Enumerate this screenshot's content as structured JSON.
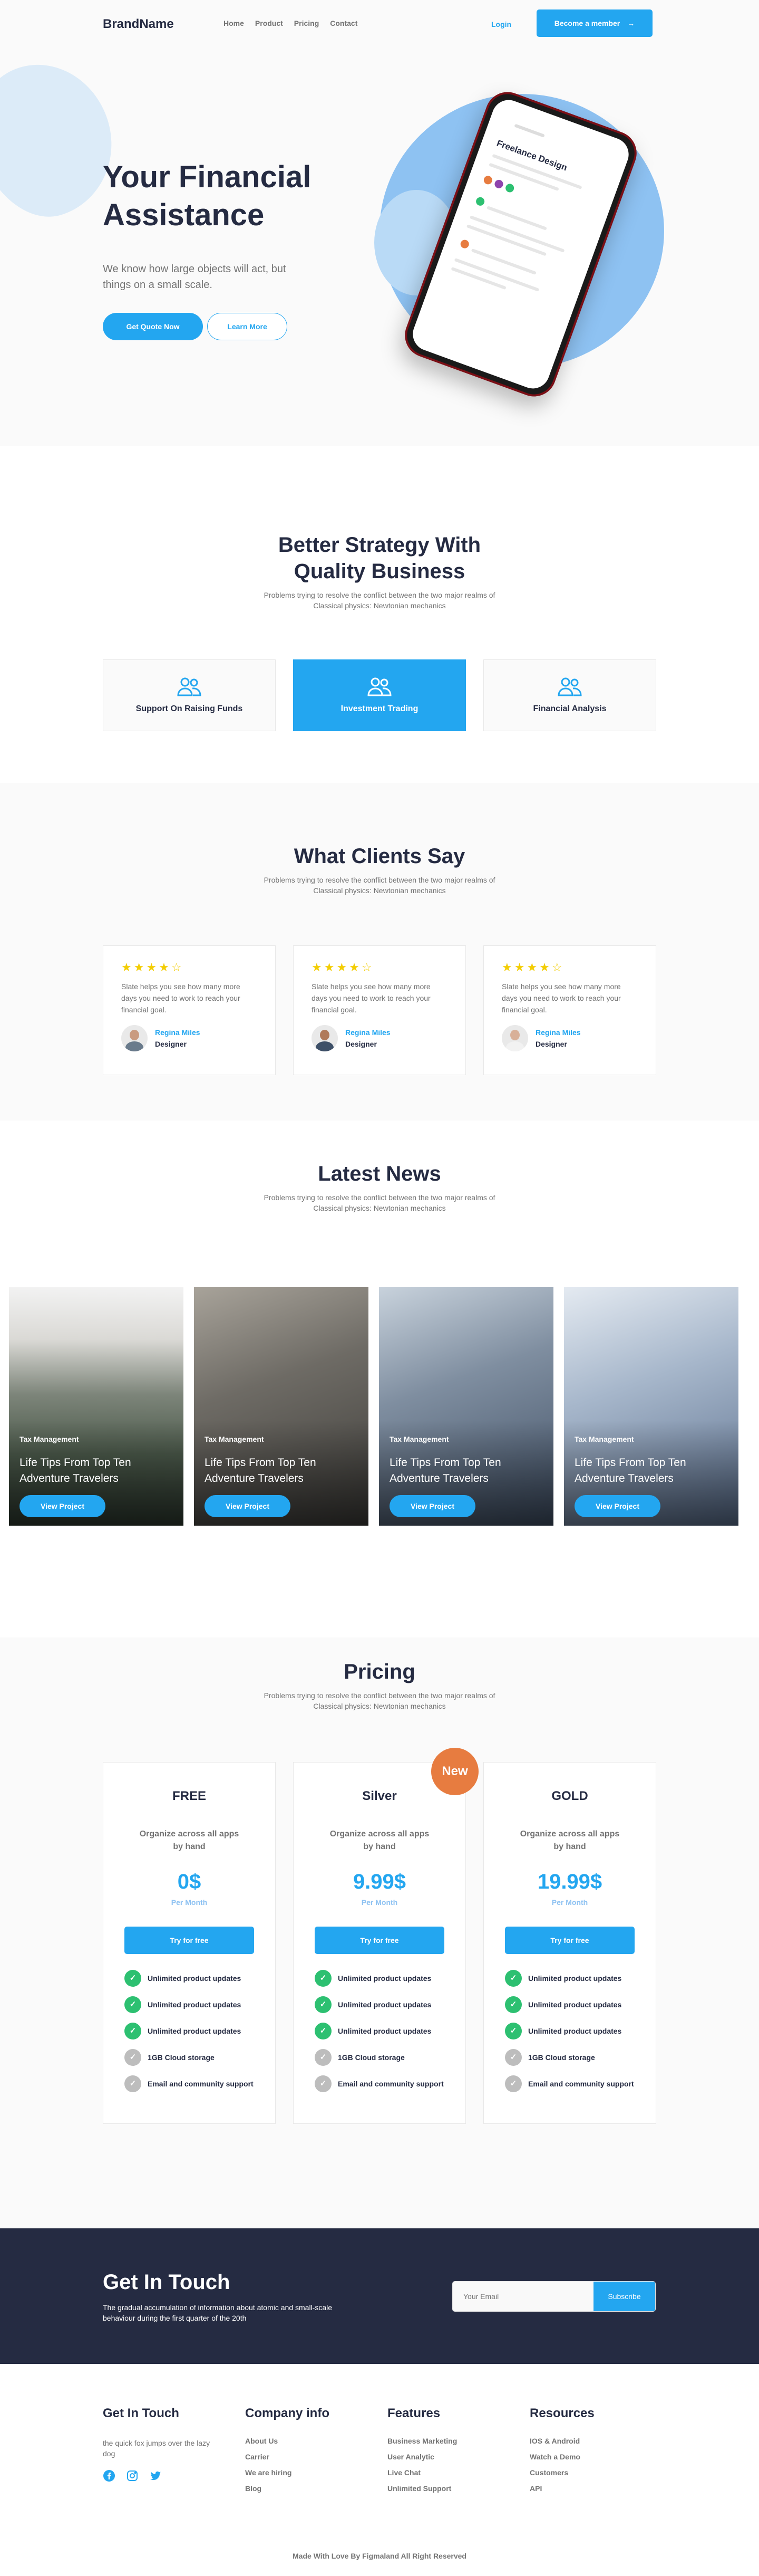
{
  "brand": "BrandName",
  "nav": {
    "links": [
      "Home",
      "Product",
      "Pricing",
      "Contact"
    ],
    "login": "Login",
    "member_button": "Become a member",
    "arrow": "→"
  },
  "hero": {
    "title": "Your Financial Assistance",
    "text": "We know how large objects will act, but things on a small scale.",
    "primary_button": "Get Quote Now",
    "secondary_button": "Learn More",
    "phone_title": "Freelance Design"
  },
  "strategy": {
    "title": "Better Strategy With Quality Business",
    "subtitle": "Problems trying to resolve the conflict between the two major realms of Classical physics: Newtonian mechanics",
    "features": [
      {
        "label": "Support On Raising Funds",
        "icon": "users-icon",
        "active": false
      },
      {
        "label": "Investment Trading",
        "icon": "users-icon",
        "active": true
      },
      {
        "label": "Financial Analysis",
        "icon": "users-icon",
        "active": false
      }
    ]
  },
  "clients": {
    "title": "What Clients Say",
    "subtitle": "Problems trying to resolve the conflict between the two major realms of Classical physics: Newtonian mechanics",
    "testimonials": [
      {
        "stars": "★★★★☆",
        "rating": 4,
        "quote": "Slate helps you see how many more days you need to work to reach your financial goal.",
        "name": "Regina Miles",
        "role": "Designer"
      },
      {
        "stars": "★★★★☆",
        "rating": 4,
        "quote": "Slate helps you see how many more days you need to work to reach your financial goal.",
        "name": "Regina Miles",
        "role": "Designer"
      },
      {
        "stars": "★★★★☆",
        "rating": 4,
        "quote": "Slate helps you see how many more days you need to work to reach your financial goal.",
        "name": "Regina Miles",
        "role": "Designer"
      }
    ]
  },
  "news": {
    "title": "Latest News",
    "subtitle": "Problems trying to resolve the conflict between the two major realms of Classical physics: Newtonian mechanics",
    "cards": [
      {
        "tag": "Tax Management",
        "title": "Life Tips From Top Ten Adventure Travelers",
        "button": "View Project"
      },
      {
        "tag": "Tax Management",
        "title": "Life Tips From Top Ten Adventure Travelers",
        "button": "View Project"
      },
      {
        "tag": "Tax Management",
        "title": "Life Tips From Top Ten Adventure Travelers",
        "button": "View Project"
      },
      {
        "tag": "Tax Management",
        "title": "Life Tips From Top Ten Adventure Travelers",
        "button": "View Project"
      }
    ]
  },
  "pricing": {
    "title": "Pricing",
    "subtitle": "Problems trying to resolve the conflict between the two major realms of Classical physics: Newtonian mechanics",
    "badge": "New",
    "plans": [
      {
        "name": "FREE",
        "desc": "Organize across all apps by hand",
        "price": "0$",
        "period": "Per Month",
        "button": "Try for free"
      },
      {
        "name": "Silver",
        "desc": "Organize across all apps by hand",
        "price": "9.99$",
        "period": "Per Month",
        "button": "Try for free"
      },
      {
        "name": "GOLD",
        "desc": "Organize across all apps by hand",
        "price": "19.99$",
        "period": "Per Month",
        "button": "Try for free"
      }
    ],
    "features": [
      {
        "text": "Unlimited product updates",
        "included": true
      },
      {
        "text": "Unlimited product updates",
        "included": true
      },
      {
        "text": "Unlimited product updates",
        "included": true
      },
      {
        "text": "1GB  Cloud storage",
        "included": false
      },
      {
        "text": "Email and community support",
        "included": false
      }
    ]
  },
  "contact": {
    "title": "Get In Touch",
    "text": "The gradual accumulation of information about atomic and small-scale behaviour during the first quarter of the 20th",
    "email_placeholder": "Your Email",
    "subscribe": "Subscribe"
  },
  "footer": {
    "col1_title": "Get In Touch",
    "col1_desc": "the quick fox jumps over the lazy dog",
    "col2_title": "Company info",
    "col2_links": [
      "About Us",
      "Carrier",
      "We are hiring",
      "Blog"
    ],
    "col3_title": "Features",
    "col3_links": [
      "Business Marketing",
      "User Analytic",
      "Live Chat",
      "Unlimited Support"
    ],
    "col4_title": "Resources",
    "col4_links": [
      "IOS & Android",
      "Watch a Demo",
      "Customers",
      "API"
    ],
    "copyright": "Made With Love By Figmaland All Right Reserved"
  },
  "colors": {
    "primary": "#23A6F0",
    "dark": "#252B42",
    "muted": "#737373",
    "success": "#2DC071",
    "badge": "#E77C40",
    "star": "#F3CD03"
  }
}
